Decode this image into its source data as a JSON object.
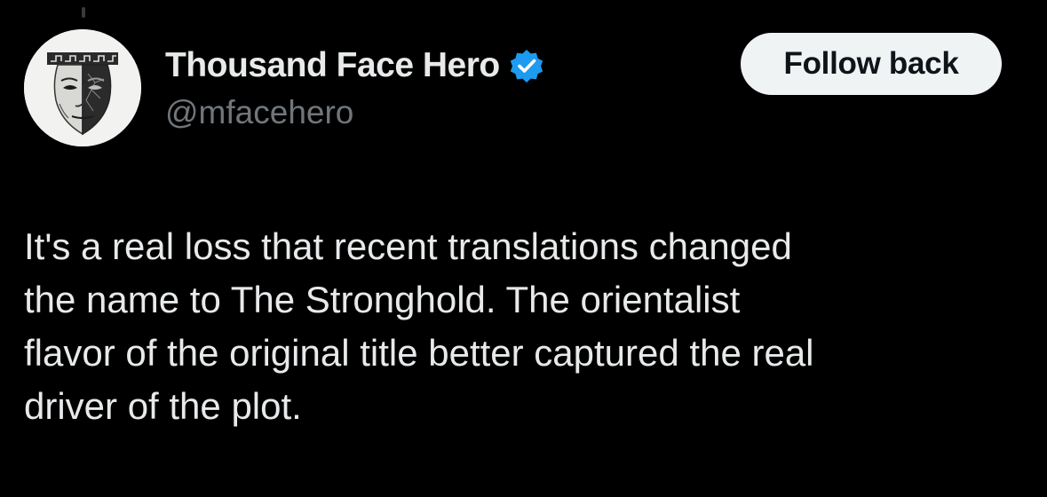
{
  "author": {
    "display_name": "Thousand Face Hero",
    "handle": "@mfacehero",
    "verified": true,
    "avatar_icon": "greek-mask-avatar-icon"
  },
  "actions": {
    "follow_label": "Follow back"
  },
  "tweet": {
    "lines": [
      "It's a real loss that recent translations changed",
      "the name to The Stronghold. The orientalist",
      "flavor of the original title better captured the real",
      "driver of the plot."
    ]
  },
  "colors": {
    "background": "#000000",
    "text_primary": "#e7e9ea",
    "text_secondary": "#71767b",
    "button_bg": "#eff3f4",
    "button_text": "#0f1419",
    "verified_blue": "#1d9bf0"
  }
}
